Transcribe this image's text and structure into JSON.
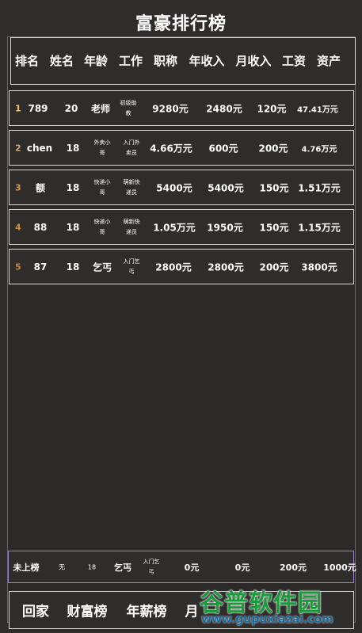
{
  "title": "富豪排行榜",
  "headers": [
    "排名",
    "姓名",
    "年龄",
    "工作",
    "职称",
    "年收入",
    "月收入",
    "工资",
    "资产"
  ],
  "rows": [
    {
      "rank": "1",
      "name": "789",
      "age": "20",
      "job": "老师",
      "title": "初级助教",
      "annual": "9280元",
      "monthly": "2480元",
      "salary": "120元",
      "assets": "47.41万元"
    },
    {
      "rank": "2",
      "name": "chen",
      "age": "18",
      "job": "外卖小哥",
      "title": "入门外卖员",
      "annual": "4.66万元",
      "monthly": "600元",
      "salary": "200元",
      "assets": "4.76万元"
    },
    {
      "rank": "3",
      "name": "额",
      "age": "18",
      "job": "快递小哥",
      "title": "萌新快递员",
      "annual": "5400元",
      "monthly": "5400元",
      "salary": "150元",
      "assets": "1.51万元"
    },
    {
      "rank": "4",
      "name": "88",
      "age": "18",
      "job": "快递小哥",
      "title": "萌新快递员",
      "annual": "1.05万元",
      "monthly": "1950元",
      "salary": "150元",
      "assets": "1.15万元"
    },
    {
      "rank": "5",
      "name": "87",
      "age": "18",
      "job": "乞丐",
      "title": "入门乞丐",
      "annual": "2800元",
      "monthly": "2800元",
      "salary": "200元",
      "assets": "3800元"
    }
  ],
  "mine": {
    "rank": "未上榜",
    "name": "无",
    "age": "18",
    "job": "乞丐",
    "title": "入门乞丐",
    "annual": "0元",
    "monthly": "0元",
    "salary": "200元",
    "assets": "1000元"
  },
  "nav": [
    "回家",
    "财富榜",
    "年薪榜",
    "月"
  ],
  "watermark": {
    "top": "谷普软件园",
    "bottom": "www.gupuxiazai.com"
  },
  "colors": {
    "background": "#2f2c2c",
    "border": "#d9d9d9",
    "mine_border": "#9a84c8",
    "rank_gold": "#f2c94c"
  }
}
